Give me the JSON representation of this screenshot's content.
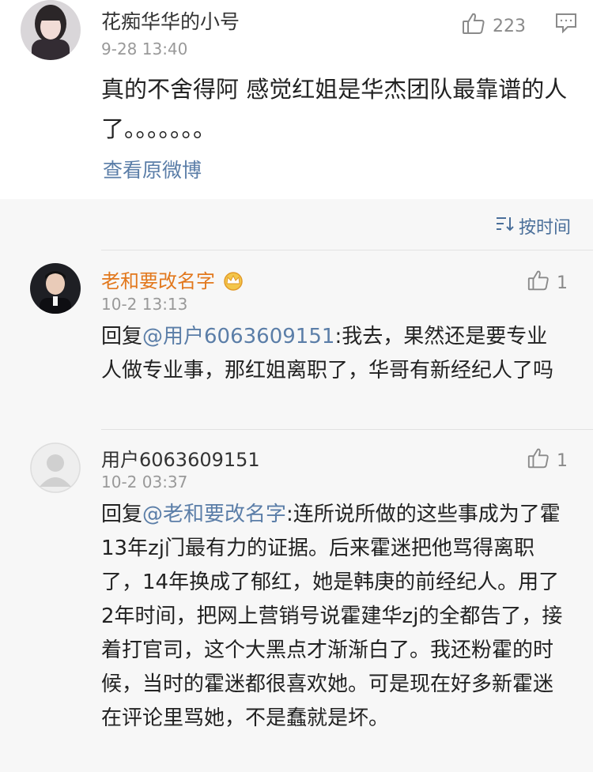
{
  "top_post": {
    "username": "花痴华华的小号",
    "time": "9-28 13:40",
    "like_count": "223",
    "text": "真的不舍得阿 感觉红姐是华杰团队最靠谱的人了。。。。。。。",
    "view_original": "查看原微博"
  },
  "sort": {
    "label": "按时间"
  },
  "comments": [
    {
      "username": "老和要改名字",
      "time": "10-2 13:13",
      "like_count": "1",
      "reply_prefix": "回复",
      "mention": "@用户6063609151",
      "text": ":我去，果然还是要专业人做专业事，那红姐离职了，华哥有新经纪人了吗"
    },
    {
      "username": "用户6063609151",
      "time": "10-2 03:37",
      "like_count": "1",
      "reply_prefix": "回复",
      "mention": "@老和要改名字",
      "text": ":连所说所做的这些事成为了霍13年zj门最有力的证据。后来霍迷把他骂得离职了，14年换成了郁红，她是韩庚的前经纪人。用了2年时间，把网上营销号说霍建华zj的全都告了，接着打官司，这个大黑点才渐渐白了。我还粉霍的时候，当时的霍迷都很喜欢她。可是现在好多新霍迷在评论里骂她，不是蠢就是坏。"
    }
  ],
  "colors": {
    "vip_name": "#e2781d",
    "link": "#5b7ea8",
    "muted": "#999999"
  }
}
